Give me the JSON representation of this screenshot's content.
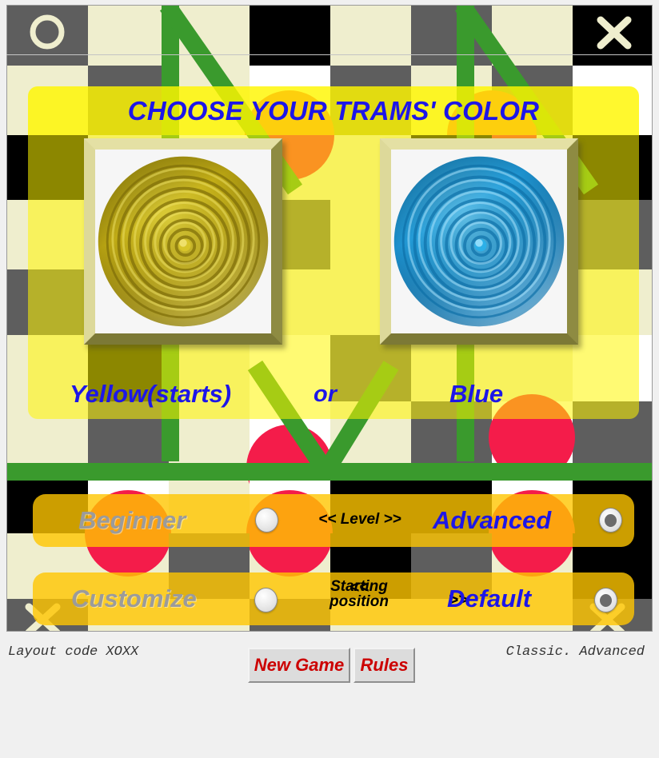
{
  "window": {
    "title": "CHOOSE YOUR TRAMS' COLOR"
  },
  "board": {
    "corner_icons": [
      {
        "name": "o-marker-icon",
        "glyph": "O",
        "position": "top-left"
      },
      {
        "name": "x-marker-icon",
        "glyph": "X",
        "position": "top-right"
      },
      {
        "name": "x-marker-icon",
        "glyph": "X",
        "position": "bottom-left"
      },
      {
        "name": "x-marker-icon",
        "glyph": "X",
        "position": "bottom-right"
      }
    ],
    "colors": {
      "light_square": "#efeece",
      "grey_square": "#5e5e5e",
      "black_square": "#000000",
      "white_square": "#ffffff",
      "red_piece": "#f41c4a",
      "green_track": "#3a9a2d",
      "green_track_dark": "#2d8a22"
    }
  },
  "dialog": {
    "title": "CHOOSE YOUR TRAMS' COLOR",
    "title_color": "#1d16e8",
    "panel_color": "#fff600",
    "pieces": [
      {
        "name": "yellow-piece",
        "color": "#d4c016",
        "label": "Yellow(starts)"
      },
      {
        "name": "blue-piece",
        "color": "#1e9fe0",
        "label": "Blue"
      }
    ],
    "labels": {
      "yellow": "Yellow(starts)",
      "or": "or",
      "blue": "Blue"
    }
  },
  "options": {
    "level": {
      "middle_label": "<< Level >>",
      "left_label": "Beginner",
      "left_selected": false,
      "right_label": "Advanced",
      "right_selected": true
    },
    "starting_position": {
      "arrow_left": "<<",
      "middle_label": "Starting position",
      "arrow_right": ">>",
      "left_label": "Customize",
      "left_selected": false,
      "right_label": "Default",
      "right_selected": true
    }
  },
  "footer": {
    "layout_code": "Layout code XOXX",
    "mode": "Classic. Advanced",
    "buttons": [
      {
        "name": "new-game-button",
        "label": "New Game"
      },
      {
        "name": "rules-button",
        "label": "Rules"
      }
    ],
    "new_game_label": "New Game",
    "rules_label": "Rules"
  }
}
